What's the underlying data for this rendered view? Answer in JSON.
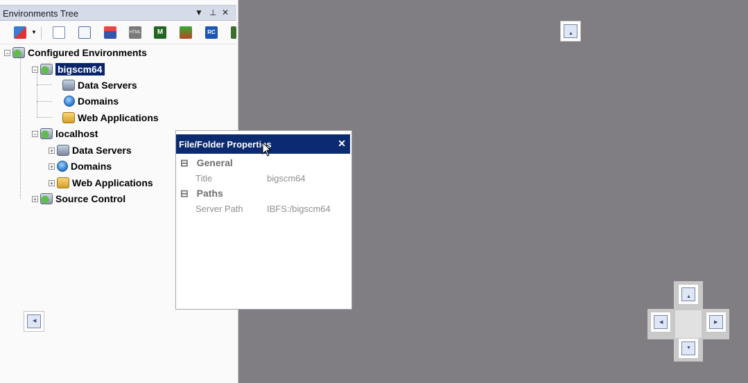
{
  "panel": {
    "title": "Environments Tree",
    "controls": {
      "dropdown": "▼",
      "pin": "⊥",
      "close": "✕"
    }
  },
  "toolbar": {
    "icons": [
      "sort-az-icon",
      "dropdown-arrow-icon",
      "copy-icon",
      "document-icon",
      "hierarchy-icon",
      "html-icon",
      "m-icon",
      "tree-icon",
      "rc-icon",
      "building-icon"
    ],
    "html_label": "HTML",
    "m_label": "M",
    "rc_label": "RC"
  },
  "tree": {
    "root": "Configured Environments",
    "env1": {
      "name": "bigscm64",
      "children": [
        "Data Servers",
        "Domains",
        "Web Applications"
      ]
    },
    "env2": {
      "name": "localhost",
      "children": [
        "Data Servers",
        "Domains",
        "Web Applications"
      ]
    },
    "source_control": "Source Control",
    "expand": "+",
    "collapse": "−"
  },
  "properties": {
    "title": "File/Folder Properties",
    "close": "✕",
    "sections": [
      {
        "name": "General",
        "toggle": "⊟",
        "rows": [
          {
            "label": "Title",
            "value": "bigscm64"
          }
        ]
      },
      {
        "name": "Paths",
        "toggle": "⊟",
        "rows": [
          {
            "label": "Server Path",
            "value": "IBFS:/bigscm64"
          }
        ]
      }
    ]
  }
}
